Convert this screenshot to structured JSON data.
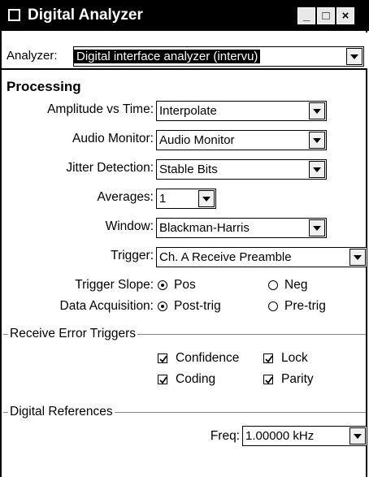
{
  "window": {
    "title": "Digital Analyzer",
    "minimize": "_",
    "maximize": "□",
    "close": "×"
  },
  "analyzer": {
    "label": "Analyzer:",
    "value": "Digital interface analyzer (intervu)"
  },
  "processing": {
    "title": "Processing",
    "amplitude_label": "Amplitude vs Time:",
    "amplitude_value": "Interpolate",
    "audio_monitor_label": "Audio Monitor:",
    "audio_monitor_value": "Audio Monitor",
    "jitter_label": "Jitter Detection:",
    "jitter_value": "Stable Bits",
    "averages_label": "Averages:",
    "averages_value": "1",
    "window_label": "Window:",
    "window_value": "Blackman-Harris",
    "trigger_label": "Trigger:",
    "trigger_value": "Ch. A Receive Preamble",
    "trigger_slope_label": "Trigger Slope:",
    "slope_pos": "Pos",
    "slope_neg": "Neg",
    "slope_selected": "Pos",
    "acquisition_label": "Data Acquisition:",
    "acq_post": "Post-trig",
    "acq_pre": "Pre-trig",
    "acq_selected": "Post-trig"
  },
  "error_triggers": {
    "title": "Receive Error Triggers",
    "confidence": "Confidence",
    "lock": "Lock",
    "coding": "Coding",
    "parity": "Parity"
  },
  "references": {
    "title": "Digital References",
    "freq_label": "Freq:",
    "freq_value": "1.00000 kHz"
  },
  "icons": {
    "app": "window-icon",
    "dropdown": "chevron-down-icon",
    "checkbox": "checkmark-icon"
  }
}
